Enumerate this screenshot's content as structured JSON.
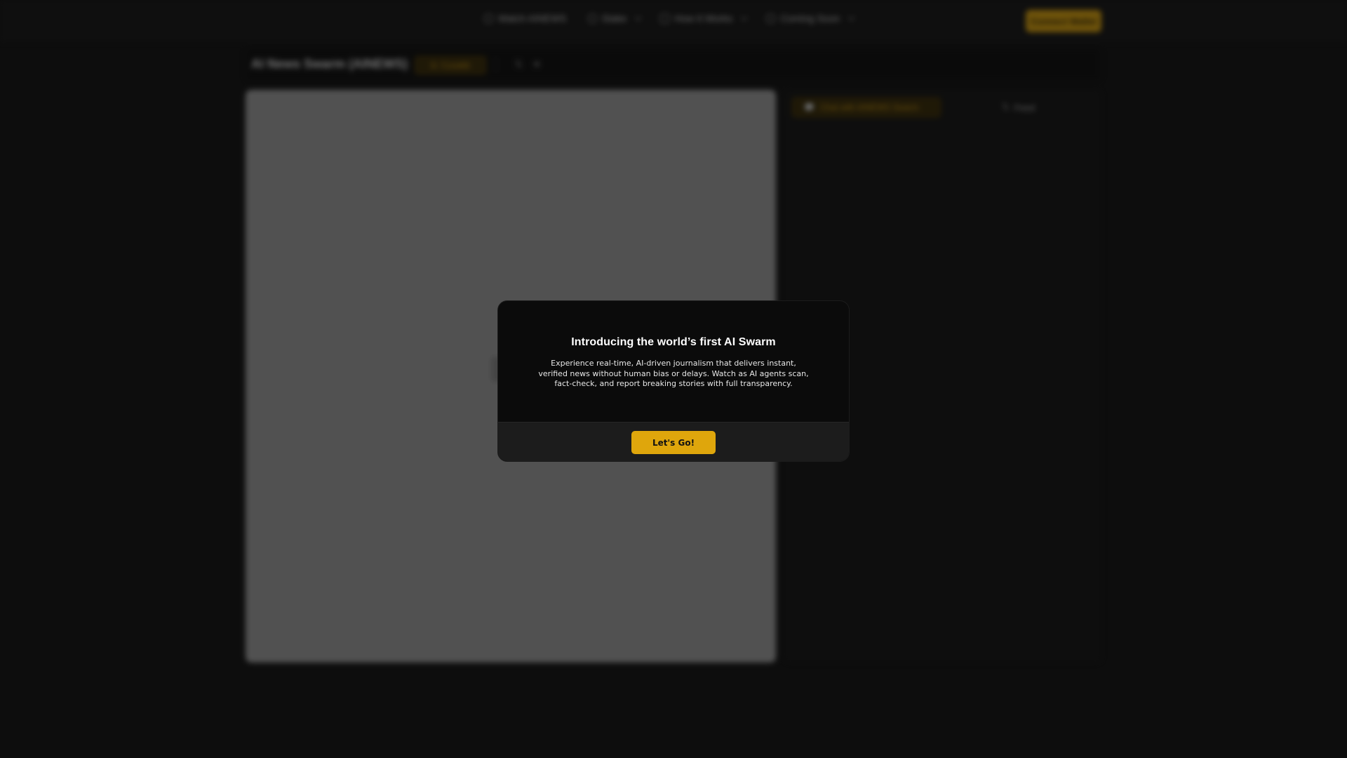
{
  "nav": {
    "items": [
      {
        "label": "Watch AINEWS",
        "icon": "circle-icon",
        "has_dropdown": false
      },
      {
        "label": "Stake",
        "icon": "pie-icon",
        "has_dropdown": true
      },
      {
        "label": "How It Works",
        "icon": "doc-icon",
        "has_dropdown": true
      },
      {
        "label": "Coming Soon",
        "icon": "clock-icon",
        "has_dropdown": true
      }
    ],
    "connect_label": "Connect Wallet"
  },
  "titlebar": {
    "coin_name": "AI News Swarm (AINEWS)",
    "badge_label": "Cusabb",
    "social_x": "𝕏",
    "social_tg": "✈"
  },
  "side_panel": {
    "chat_label": "Chat with AINEWS Swarm",
    "feed_label": "Feed",
    "feed_icon": "𝕏"
  },
  "modal": {
    "title": "Introducing the world’s first AI Swarm",
    "body": "Experience real-time, AI-driven journalism that delivers instant, verified news without human bias or delays. Watch as AI agents scan, fact-check, and report breaking stories with full transparency.",
    "cta_label": "Let's Go!"
  },
  "colors": {
    "accent": "#dfa60c",
    "background": "#121212",
    "modal_bg": "#0b0b0b",
    "modal_footer_bg": "#1c1c1c"
  }
}
